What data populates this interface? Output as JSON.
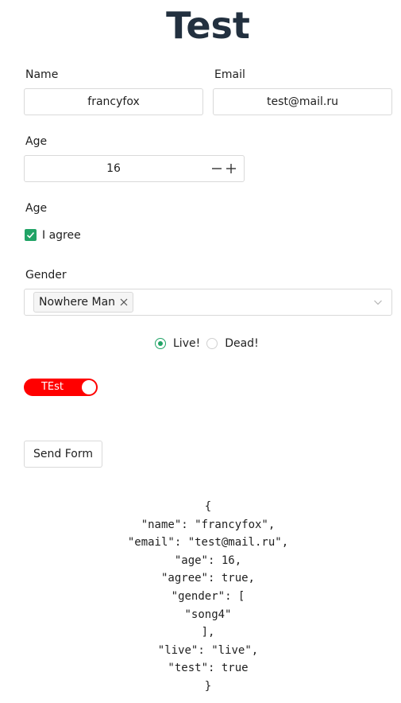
{
  "title": "Test",
  "form": {
    "name_label": "Name",
    "name_value": "francyfox",
    "email_label": "Email",
    "email_value": "test@mail.ru",
    "age_label": "Age",
    "age_value": "16",
    "agree_section_label": "Age",
    "agree_label": "I agree",
    "agree_checked": true,
    "gender_label": "Gender",
    "gender_tag": "Nowhere Man",
    "radio_live_label": "Live!",
    "radio_dead_label": "Dead!",
    "radio_selected": "Live!",
    "toggle_label": "TEst",
    "toggle_on": true,
    "send_label": "Send Form"
  },
  "colors": {
    "accent": "#21a366",
    "toggle": "#ff0000",
    "title": "#22303f"
  },
  "icons": {
    "stepper_minus": "minus-icon",
    "stepper_plus": "plus-icon",
    "checkbox": "check-icon",
    "tag_close": "close-icon",
    "select_chevron": "chevron-down-icon"
  },
  "output": {
    "lines": [
      "{",
      "\"name\": \"francyfox\",",
      "\"email\": \"test@mail.ru\",",
      "\"age\": 16,",
      "\"agree\": true,",
      "\"gender\": [",
      "\"song4\"",
      "],",
      "\"live\": \"live\",",
      "\"test\": true",
      "}"
    ]
  }
}
